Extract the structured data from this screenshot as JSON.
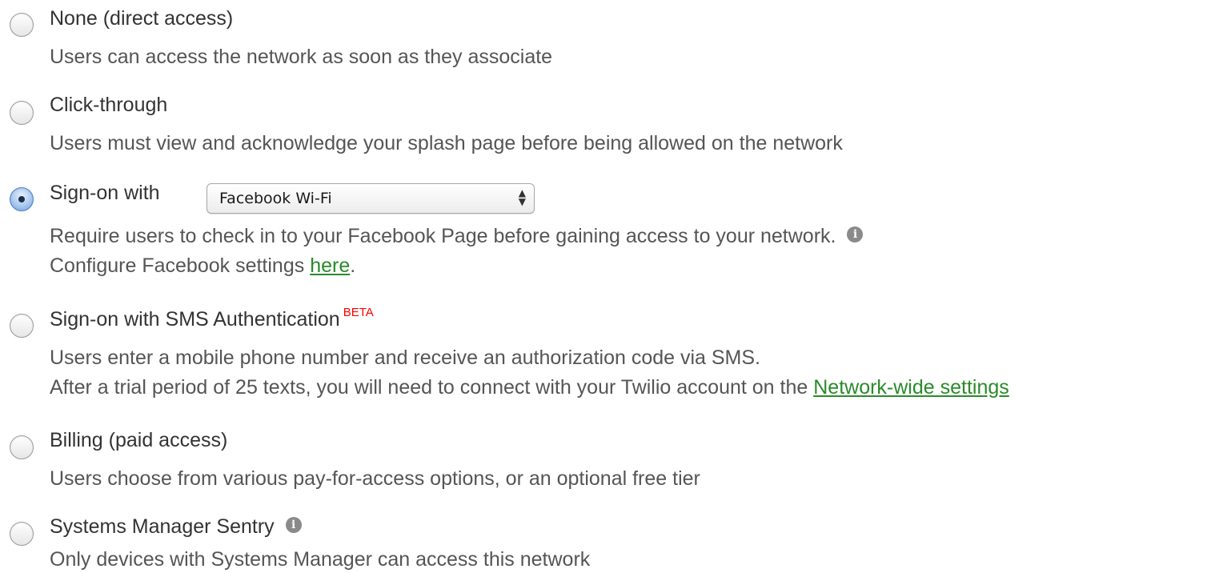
{
  "options": [
    {
      "title": "None (direct access)",
      "description": "Users can access the network as soon as they associate",
      "selected": false
    },
    {
      "title": "Click-through",
      "description": "Users must view and acknowledge your splash page before being allowed on the network",
      "selected": false
    },
    {
      "title": "Sign-on with",
      "selected": true,
      "select_value": "Facebook Wi-Fi",
      "description_line1": "Require users to check in to your Facebook Page before gaining access to your network.",
      "description_line2_prefix": "Configure Facebook settings ",
      "description_line2_link": "here",
      "description_line2_suffix": "."
    },
    {
      "title": "Sign-on with SMS Authentication",
      "badge": "BETA",
      "selected": false,
      "description_line1": "Users enter a mobile phone number and receive an authorization code via SMS.",
      "description_line2_prefix": "After a trial period of 25 texts, you will need to connect with your Twilio account on the ",
      "description_line2_link": "Network-wide settings"
    },
    {
      "title": "Billing (paid access)",
      "description": "Users choose from various pay-for-access options, or an optional free tier",
      "selected": false
    },
    {
      "title": "Systems Manager Sentry",
      "description": "Only devices with Systems Manager can access this network",
      "selected": false
    }
  ],
  "icons": {
    "info": "info-icon",
    "info_glyph": "i"
  },
  "colors": {
    "link": "#2a8a2a",
    "badge": "#ff0000",
    "radio_selected": "#6d9ee0"
  }
}
